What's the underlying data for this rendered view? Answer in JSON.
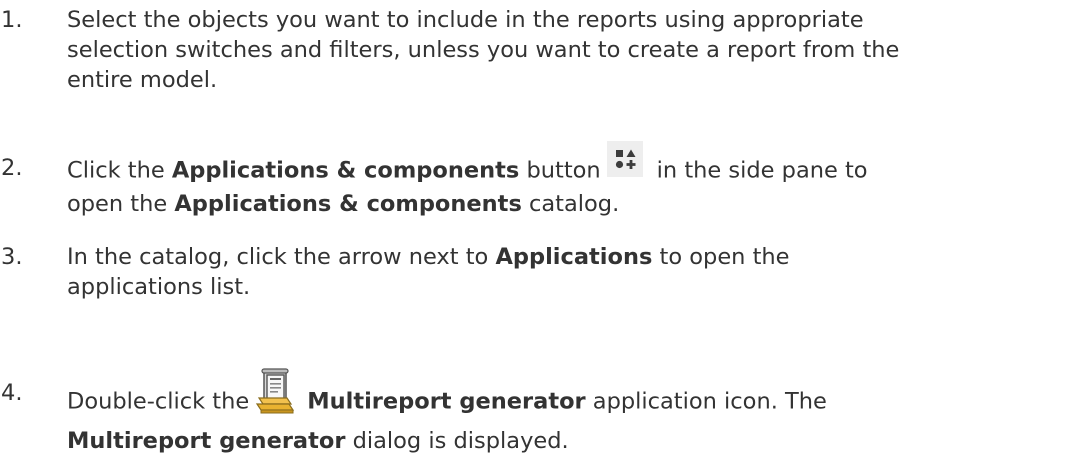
{
  "steps": [
    {
      "number": "1.",
      "line1": "Select the objects you want to include in the reports using appropriate",
      "line2": "selection switches and filters, unless you want to create a report from the",
      "line3": "entire model."
    },
    {
      "number": "2.",
      "pre": "Click the ",
      "bold1": "Applications & components",
      "mid": " button",
      "post": "in the side pane to",
      "line2_pre": "open the ",
      "bold2": "Applications & components",
      "line2_post": " catalog.",
      "icon": "applications-components-icon"
    },
    {
      "number": "3.",
      "pre": "In the catalog, click the arrow next to ",
      "bold1": "Applications",
      "post": " to open the",
      "line2": "applications list."
    },
    {
      "number": "4.",
      "pre": "Double-click the",
      "bold1": "Multireport generator",
      "post": " application icon. The",
      "bold2": "Multireport generator",
      "line2_post": " dialog is displayed.",
      "icon": "multireport-generator-icon"
    }
  ]
}
